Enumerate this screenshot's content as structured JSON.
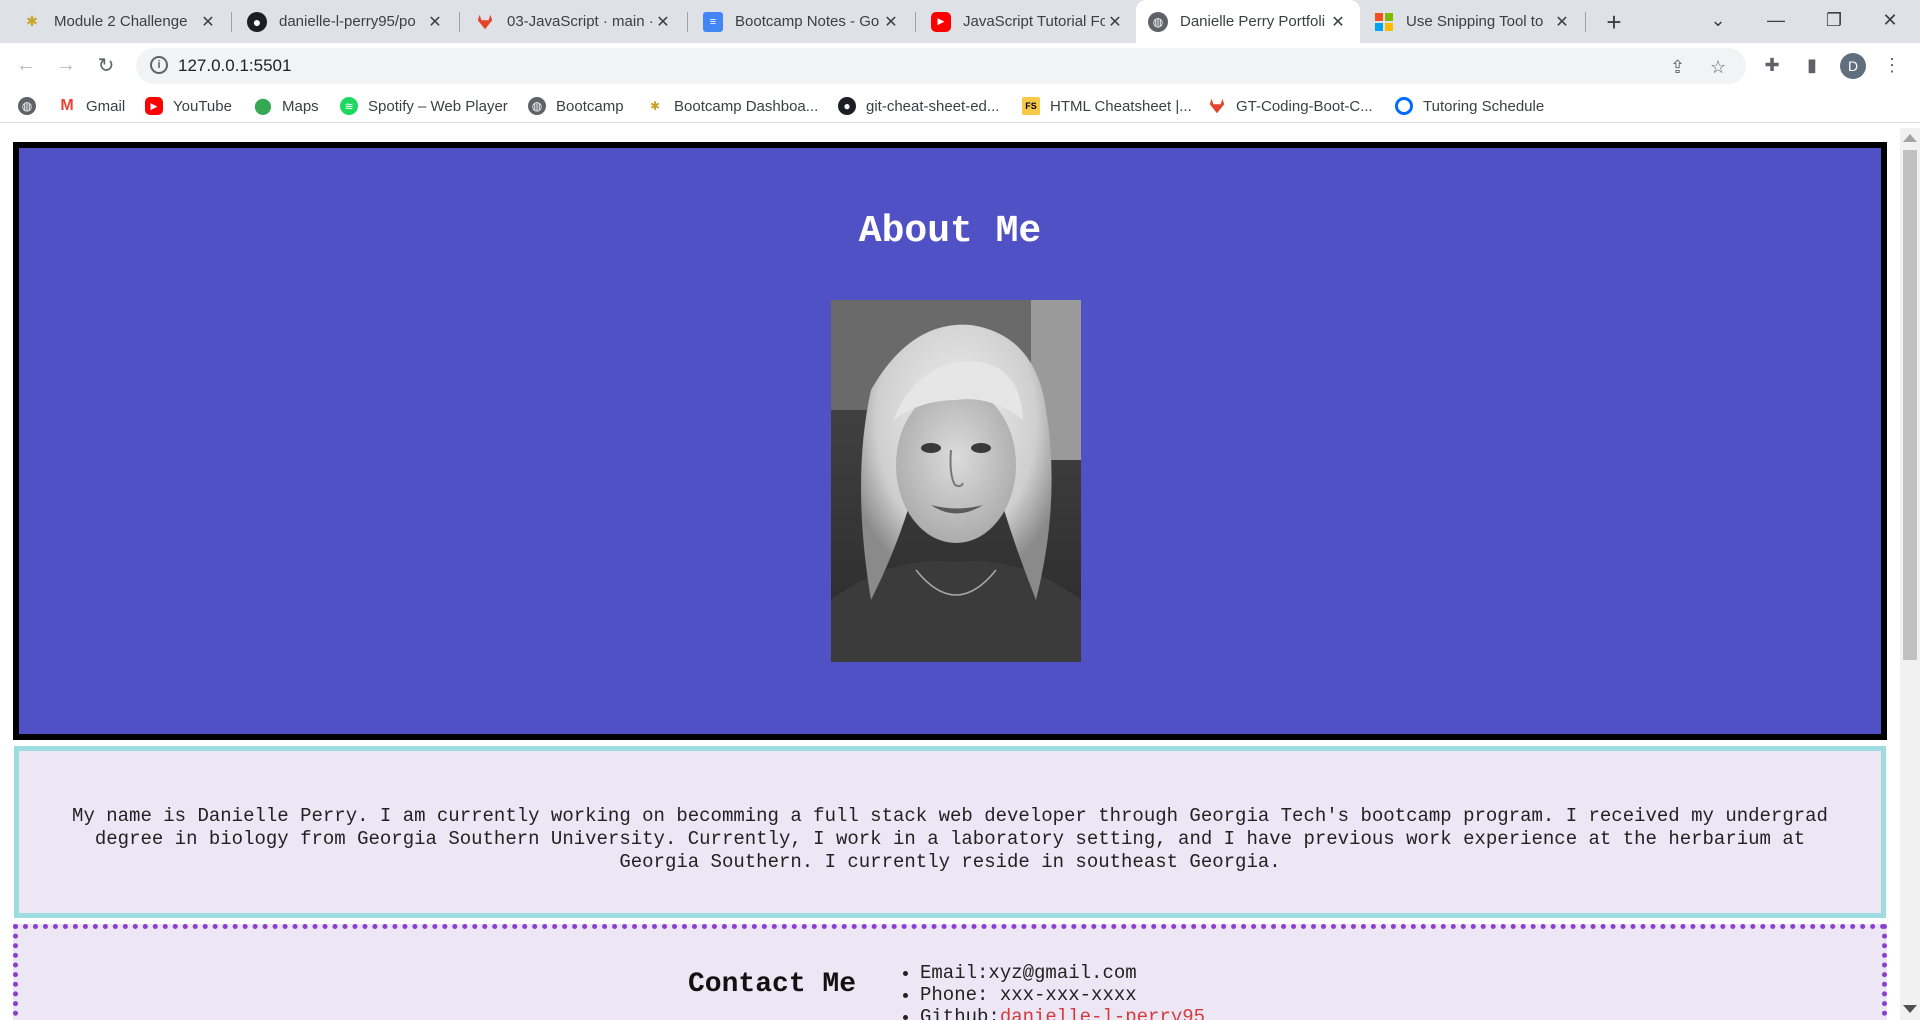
{
  "browser": {
    "tabs": [
      {
        "title": "Module 2 Challenge",
        "favicon": "bee-icon",
        "active": false
      },
      {
        "title": "danielle-l-perry95/po",
        "favicon": "github-icon",
        "active": false
      },
      {
        "title": "03-JavaScript · main ·",
        "favicon": "gitlab-icon",
        "active": false
      },
      {
        "title": "Bootcamp Notes - Go",
        "favicon": "google-docs-icon",
        "active": false
      },
      {
        "title": "JavaScript Tutorial For",
        "favicon": "youtube-icon",
        "active": false
      },
      {
        "title": "Danielle Perry Portfoli",
        "favicon": "globe-icon",
        "active": true
      },
      {
        "title": "Use Snipping Tool to",
        "favicon": "microsoft-icon",
        "active": false
      }
    ],
    "url": "127.0.0.1:5501",
    "profile_initial": "D",
    "bookmarks": [
      {
        "label": "",
        "icon": "globe-icon"
      },
      {
        "label": "Gmail",
        "icon": "gmail-icon"
      },
      {
        "label": "YouTube",
        "icon": "youtube-icon"
      },
      {
        "label": "Maps",
        "icon": "maps-icon"
      },
      {
        "label": "Spotify – Web Player",
        "icon": "spotify-icon"
      },
      {
        "label": "Bootcamp",
        "icon": "globe-icon"
      },
      {
        "label": "Bootcamp Dashboa...",
        "icon": "bee-icon"
      },
      {
        "label": "git-cheat-sheet-ed...",
        "icon": "github-icon"
      },
      {
        "label": "HTML Cheatsheet |...",
        "icon": "fs-icon"
      },
      {
        "label": "GT-Coding-Boot-C...",
        "icon": "gitlab-icon"
      },
      {
        "label": "Tutoring Schedule",
        "icon": "calendly-icon"
      }
    ]
  },
  "page": {
    "about_heading": "About Me",
    "bio": "My name is Danielle Perry. I am currently working on becomming a full stack web developer through Georgia Tech's bootcamp program. I received my undergrad degree in biology from Georgia Southern University. Currently, I work in a laboratory setting, and I have previous work experience at the herbarium at Georgia Southern. I currently reside in southeast Georgia.",
    "contact_heading": "Contact Me",
    "contact": {
      "email_label": "Email:",
      "email_value": "xyz@gmail.com",
      "phone_label": "Phone:",
      "phone_value": "xxx-xxx-xxxx",
      "github_label": "Github:",
      "github_value": "danielle-l-perry95"
    }
  },
  "colors": {
    "about_bg": "#5151c6",
    "bio_bg": "#ece6f5",
    "bio_border": "#9fdcdf",
    "contact_border": "#8a3fd1",
    "link": "#d63b3b"
  }
}
